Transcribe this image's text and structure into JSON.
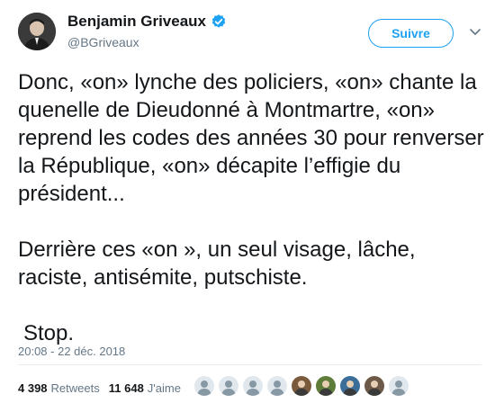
{
  "author": {
    "name": "Benjamin Griveaux",
    "handle": "@BGriveaux"
  },
  "follow_button": {
    "label": "Suivre"
  },
  "tweet": {
    "paragraphs": [
      "Donc, «on» lynche des policiers, «on» chante la quenelle de Dieudonné à Montmartre, «on» reprend les codes des années 30 pour renverser la République, «on» décapite l’effigie du président...",
      "Derrière ces «on », un seul visage, lâche, raciste, antisémite, putschiste.",
      "Stop."
    ],
    "timestamp": "20:08 - 22 déc. 2018"
  },
  "stats": {
    "retweets_count": "4 398",
    "retweets_label": "Retweets",
    "likes_count": "11 648",
    "likes_label": "J'aime"
  },
  "likers": [
    {
      "icon": "default-avatar-icon",
      "color": "#8899a6"
    },
    {
      "icon": "default-avatar-icon",
      "color": "#8899a6"
    },
    {
      "icon": "default-avatar-icon",
      "color": "#8899a6"
    },
    {
      "icon": "default-avatar-icon",
      "color": "#8899a6"
    },
    {
      "icon": "user-photo-icon",
      "color": "#7a5a3c"
    },
    {
      "icon": "user-photo-icon",
      "color": "#5f7d3a"
    },
    {
      "icon": "user-photo-icon",
      "color": "#3c6e9a"
    },
    {
      "icon": "user-photo-icon",
      "color": "#6e5a48"
    },
    {
      "icon": "default-avatar-icon",
      "color": "#8899a6"
    }
  ],
  "colors": {
    "accent": "#1da1f2",
    "secondary_text": "#657786",
    "primary_text": "#14171a"
  }
}
